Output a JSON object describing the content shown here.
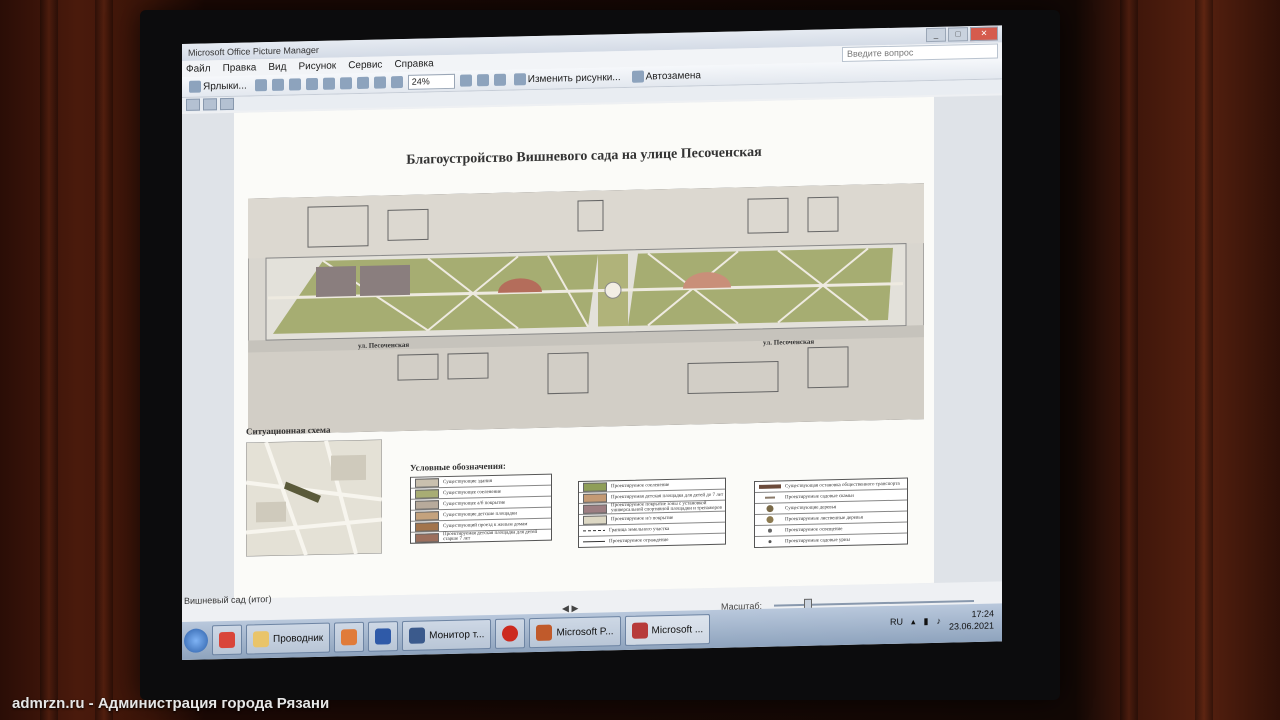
{
  "window": {
    "title": "Microsoft Office Picture Manager",
    "buttons": [
      "_",
      "□",
      "✕"
    ]
  },
  "menu": {
    "items": [
      "Файл",
      "Правка",
      "Вид",
      "Рисунок",
      "Сервис",
      "Справка"
    ],
    "question_placeholder": "Введите вопрос"
  },
  "toolbar": {
    "shortcuts_label": "Ярлыки...",
    "zoom": "24%",
    "edit_pictures_label": "Изменить рисунки...",
    "autocorrect_label": "Автозамена"
  },
  "document": {
    "title": "Благоустройство Вишневого сада на улице Песоченская",
    "street_label_left": "ул. Песоченская",
    "street_label_right": "ул. Песоченская",
    "situation_label": "Ситуационная схема",
    "legend_title": "Условные обозначения:",
    "legend_col1": [
      {
        "text": "Существующие здания",
        "color": "#c9c0ae"
      },
      {
        "text": "Существующее озеленение",
        "color": "#a8ad74"
      },
      {
        "text": "Существующее а/б покрытие",
        "color": "#b7aa9b"
      },
      {
        "text": "Существующие детские площадки",
        "color": "#c4a27d"
      },
      {
        "text": "Существующий проезд к жилым домам",
        "color": "#a2744c"
      },
      {
        "text": "Проектируемая детская площадка для детей старше 7 лет",
        "color": "#9c6f5d"
      }
    ],
    "legend_col2": [
      {
        "text": "Проектируемое озеленение",
        "color": "#8f9e58"
      },
      {
        "text": "Проектируемая детская площадка для детей до 7 лет",
        "color": "#c49a74"
      },
      {
        "text": "Проектируемое покрытие зоны с установкой универсальной спортивной площадки и тренажеров",
        "color": "#9d7e82"
      },
      {
        "text": "Проектируемое н/з покрытие",
        "color": "#ddd8c4"
      },
      {
        "text": "Граница земельного участка",
        "color": "#ffffff"
      },
      {
        "text": "Проектируемое ограждение",
        "color": "#ffffff"
      }
    ],
    "legend_col3": [
      {
        "text": "Существующая остановка общественного транспорта",
        "color": "#6b4a3a"
      },
      {
        "text": "Проектируемые садовые скамьи",
        "color": "#8a7a6a"
      },
      {
        "text": "Существующие деревья",
        "color": "#7a6a48"
      },
      {
        "text": "Проектируемые лиственные деревья",
        "color": "#8c7a50"
      },
      {
        "text": "Проектируемое освещение",
        "color": "#666666"
      },
      {
        "text": "Проектируемые садовые урны",
        "color": "#555555"
      }
    ]
  },
  "status": {
    "filename": "Вишневый сад (итог)",
    "scale_label": "Масштаб:"
  },
  "taskbar": {
    "items": [
      {
        "label": "",
        "icon_color": "#d9453a"
      },
      {
        "label": "Проводник",
        "icon_color": "#e9c46a"
      },
      {
        "label": "",
        "icon_color": "#e07b39"
      },
      {
        "label": "",
        "icon_color": "#2f5aa8"
      },
      {
        "label": "Монитор т...",
        "icon_color": "#3b5a8c"
      },
      {
        "label": "",
        "icon_color": "#cc2a1f"
      },
      {
        "label": "Microsoft P...",
        "icon_color": "#c05a2b"
      },
      {
        "label": "Microsoft ...",
        "icon_color": "#b73a3a"
      }
    ],
    "language": "RU",
    "time": "17:24",
    "date": "23.06.2021"
  },
  "watermark": "admrzn.ru - Администрация города Рязани"
}
